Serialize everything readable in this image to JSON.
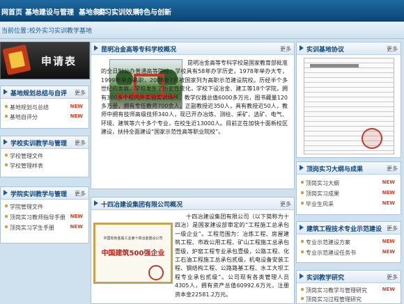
{
  "nav": [
    "网首页",
    "基地建设与管理",
    "基地条件",
    "实习实训效果",
    "特色与创新"
  ],
  "location": {
    "label": "当前位置：",
    "path": "校外实习实训教学基地"
  },
  "apply_banner": {
    "text": "申请表"
  },
  "more": "更多",
  "new_badge": "NEW",
  "left": {
    "planning": {
      "title": "基地规划总结与自评",
      "items": [
        "基地规划与总结",
        "基地自评分"
      ]
    },
    "management": {
      "title": "学校实训教学与管理",
      "items": [
        "学校管理文件",
        "学校管理样表"
      ]
    },
    "college": {
      "title": "学院实训教学与管理",
      "items": [
        "学院管理文件",
        "顶岗实习教师指导手册",
        "顶岗实习学生手册"
      ]
    }
  },
  "school": {
    "title": "昆明冶金高等专科学校概况",
    "text": "昆明冶金高等专科学校是国家教育部批准的全日制公办普通高等院校，学校具有58年办学历史，1978年举办大专，1999年举办高职，2008年7月被国家列为高职示范建设院校。历经半个多世纪的发展，学校发生了历史性变化，学校下设冶金、建工等18个学院，拥有300多个校内外实验实训场所，教学仪器总值6000多万元，图书藏量120多万册，拥有专任教师700余人，正副教授近350人，具有教授近50人，教师中拥有技师高级技师340人，现已开办冶炼、测绘、采矿、选矿、电气、环境、建筑等六十多个专业，在校生近13000人。目前正在加快十面新校区建设，扶持全面建设“国家示范性高等职业院校”。"
  },
  "company": {
    "title": "十四冶建设集团有限公司概况",
    "certificate": "中国建筑500强企业",
    "cert_sub": "中国有色金属工业第十四冶金建设公司",
    "text": "十四冶建设集团有限公司（以下简称为十四冶）是国家建设部审定的“工程施工总承包一级企业”。工程范围为：冶炼工程、房屋建筑工程、市政公用工程、矿山工程施工总承包壹级，炉窑工程专业承包壹级，公路工程、化工石油工程施工总承包贰级，机电设备安装工程、钢结构工程、公路路基工程、水工大坝工程专业承包贰级”。公司现有各类管理人员4305人，拥有资产总值60992.6万元，注册资本金22581.2万元。"
  },
  "right": {
    "agreement": {
      "title": "实训基地协议"
    },
    "outline": {
      "title": "顶岗实习大纲与成果",
      "items": [
        "顶岗实习大纲",
        "顶岗实习成果",
        "毕业生风采"
      ]
    },
    "reform": {
      "title": "建筑工程技术专业示范建设",
      "items": [
        "专业示范建设方案",
        "专业示范建设任务书"
      ]
    },
    "research": {
      "title": "实训教学研究",
      "items": [
        "顶岗实习教学与管理研究",
        "顶岗实习过程管理研究"
      ]
    }
  },
  "colors": {
    "nav_bg": "#0b4676",
    "panel_title": "#12467a",
    "new": "#e23b1a",
    "accent_gold": "#c8a34a"
  }
}
